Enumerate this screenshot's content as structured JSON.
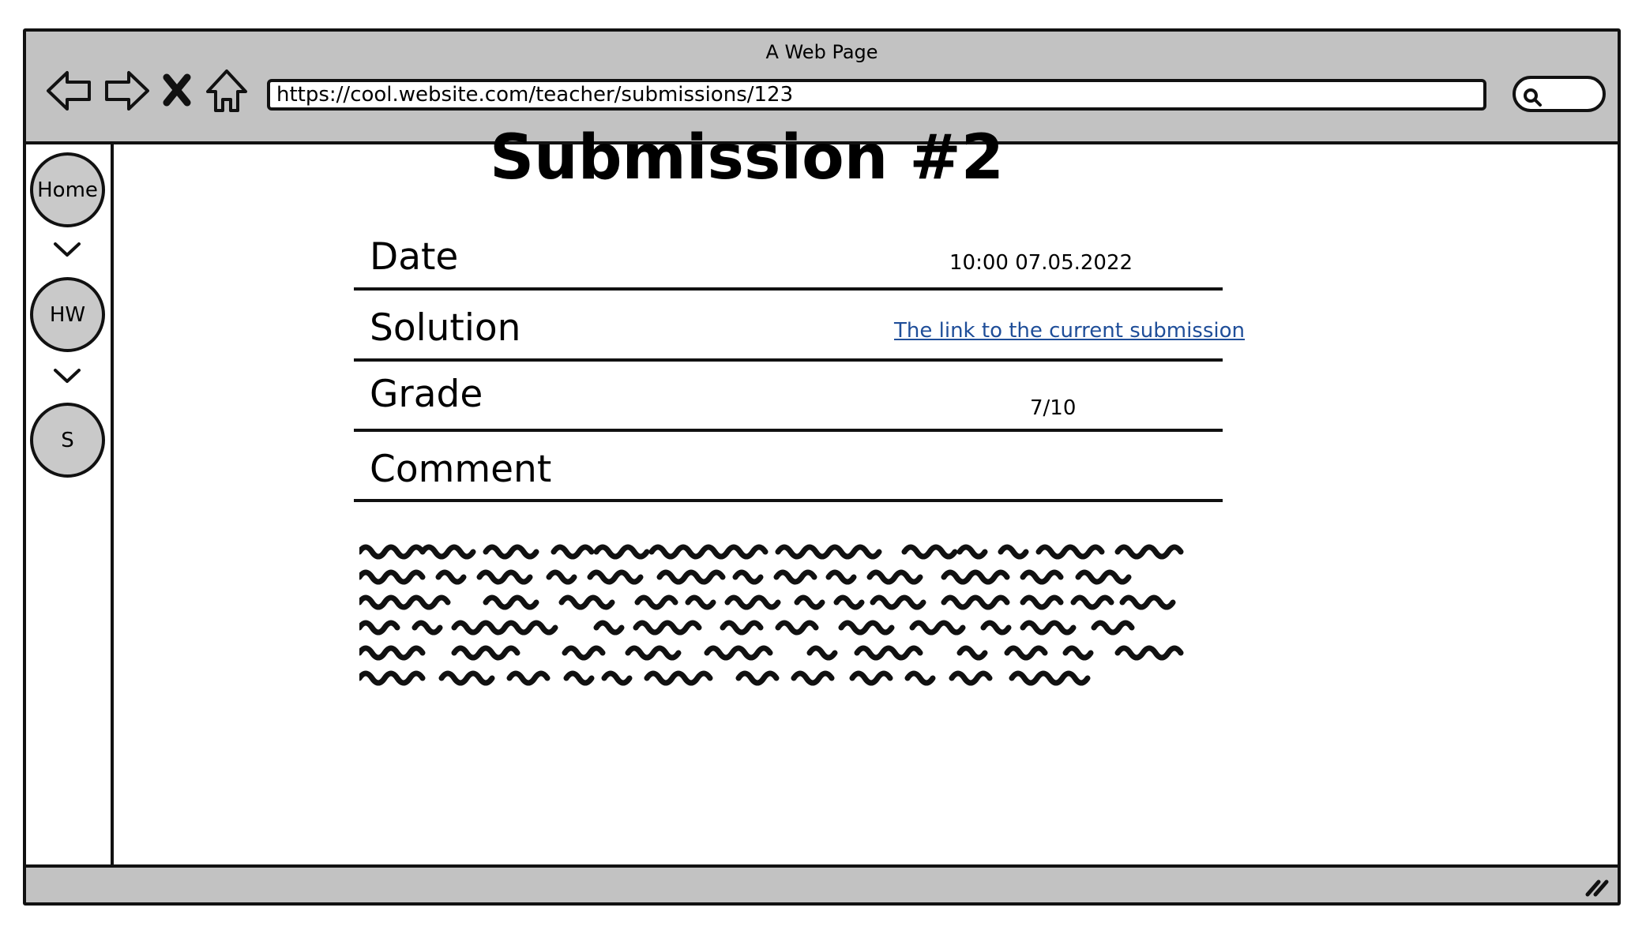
{
  "window": {
    "title": "A Web Page",
    "url": "https://cool.website.com/teacher/submissions/123",
    "nav_icons": [
      "back-arrow-icon",
      "forward-arrow-icon",
      "stop-icon",
      "home-icon"
    ],
    "search_icon": "search-icon"
  },
  "sidebar": {
    "items": [
      {
        "label": "Home"
      },
      {
        "label": "HW"
      },
      {
        "label": "S"
      }
    ]
  },
  "page": {
    "title": "Submission #2",
    "fields": {
      "date": {
        "label": "Date",
        "value": "10:00 07.05.2022"
      },
      "solution": {
        "label": "Solution",
        "link_text": "The link to the current submission"
      },
      "grade": {
        "label": "Grade",
        "value": "7/10"
      },
      "comment": {
        "label": "Comment"
      }
    },
    "comment_placeholder": "scribbled-text"
  },
  "colors": {
    "chrome": "#c2c2c2",
    "sidebar_button": "#c9c9c9",
    "link": "#1f4e99",
    "border": "#111111"
  }
}
